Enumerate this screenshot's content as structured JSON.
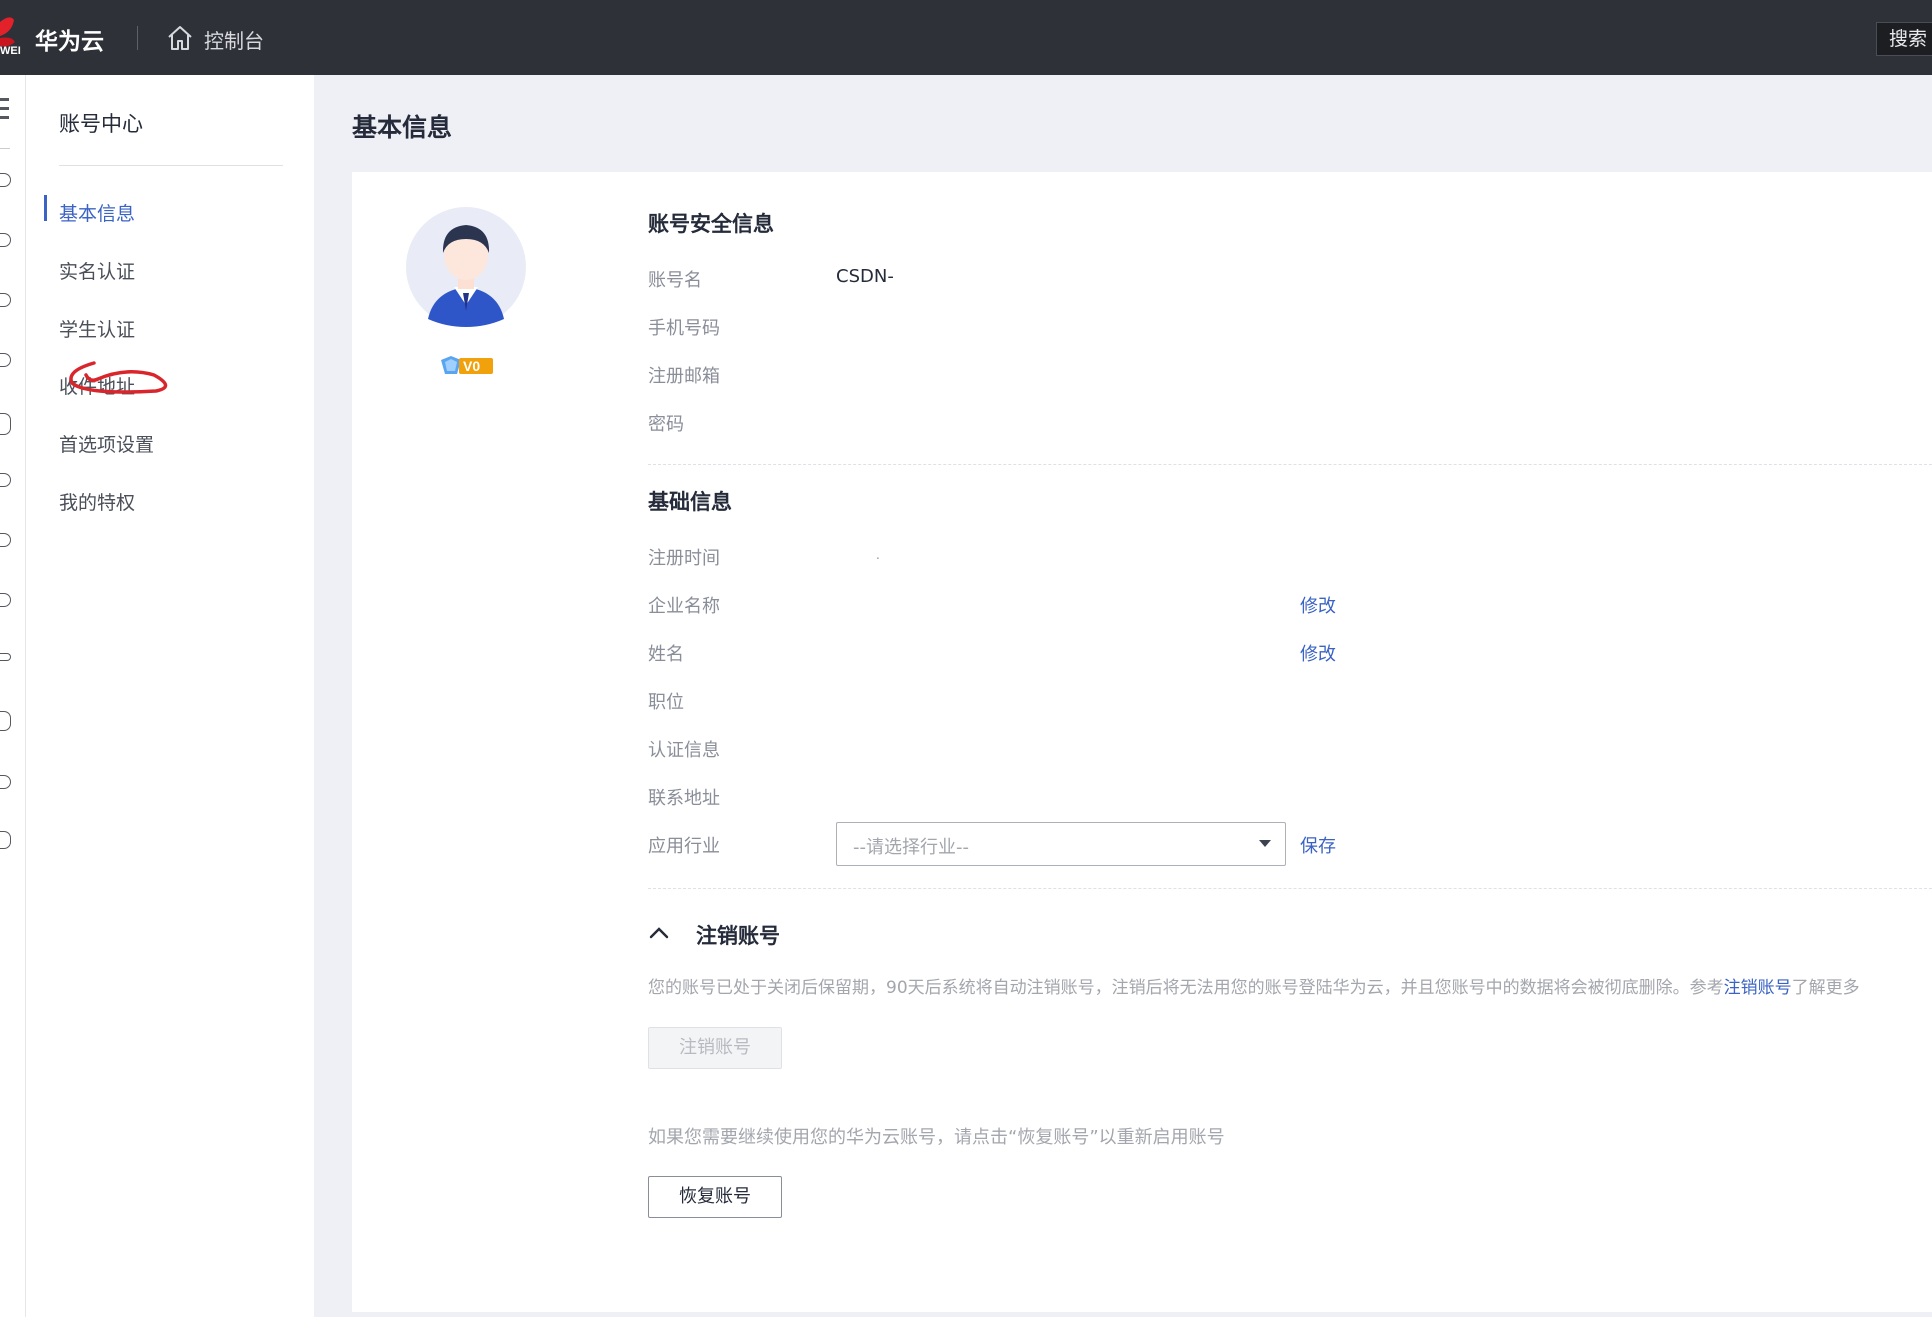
{
  "topbar": {
    "logo_sub": "WEI",
    "brand": "华为云",
    "console": "控制台",
    "search": "搜索"
  },
  "sidebar": {
    "title": "账号中心",
    "items": [
      {
        "label": "基本信息",
        "active": true
      },
      {
        "label": "实名认证"
      },
      {
        "label": "学生认证"
      },
      {
        "label": "收件地址"
      },
      {
        "label": "首选项设置"
      },
      {
        "label": "我的特权"
      }
    ]
  },
  "page": {
    "title": "基本信息"
  },
  "profile": {
    "vip_level": "V0"
  },
  "security": {
    "title": "账号安全信息",
    "fields": [
      {
        "label": "账号名",
        "value": "CSDN-"
      },
      {
        "label": "手机号码",
        "value": ""
      },
      {
        "label": "注册邮箱",
        "value": ""
      },
      {
        "label": "密码",
        "value": ""
      }
    ]
  },
  "basic": {
    "title": "基础信息",
    "fields": [
      {
        "label": "注册时间",
        "value": "."
      },
      {
        "label": "企业名称",
        "action": "修改"
      },
      {
        "label": "姓名",
        "action": "修改"
      },
      {
        "label": "职位"
      },
      {
        "label": "认证信息"
      },
      {
        "label": "联系地址"
      },
      {
        "label": "应用行业"
      }
    ],
    "industry_select": {
      "placeholder": "--请选择行业--"
    },
    "save": "保存"
  },
  "cancel_section": {
    "title": "注销账号",
    "notice_before": "您的账号已处于关闭后保留期，90天后系统将自动注销账号，注销后将无法用您的账号登陆华为云，并且您账号中的数据将会被彻底删除。参考",
    "notice_link": "注销账号",
    "notice_after": "了解更多",
    "cancel_button": "注销账号",
    "recover_note": "如果您需要继续使用您的华为云账号，请点击“恢复账号”以重新启用账号",
    "recover_button": "恢复账号"
  },
  "colors": {
    "topbar": "#2e3138",
    "accent": "#3b63c4",
    "annotation": "#d9262c"
  }
}
